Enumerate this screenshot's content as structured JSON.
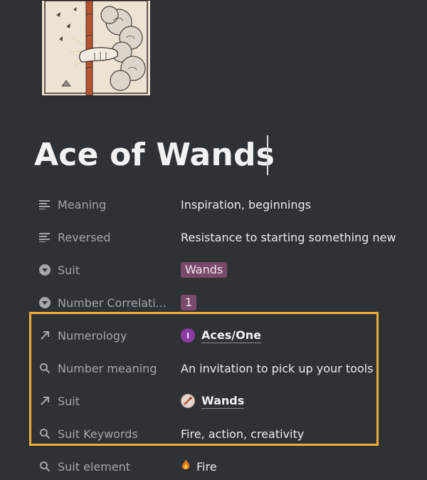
{
  "page": {
    "title": "Ace of Wands"
  },
  "properties": [
    {
      "label": "Meaning",
      "icon": "text-lines-icon",
      "type": "text",
      "value": "Inspiration, beginnings"
    },
    {
      "label": "Reversed",
      "icon": "text-lines-icon",
      "type": "text",
      "value": "Resistance to starting something new"
    },
    {
      "label": "Suit",
      "icon": "select-chevron-icon",
      "type": "select",
      "value": "Wands"
    },
    {
      "label": "Number Correlati...",
      "icon": "select-chevron-icon",
      "type": "select",
      "value": "1"
    },
    {
      "label": "Numerology",
      "icon": "relation-arrow-icon",
      "type": "relation",
      "value": "Aces/One",
      "badge": "I"
    },
    {
      "label": "Number meaning",
      "icon": "magnifier-icon",
      "type": "rollup",
      "value": "An invitation to pick up your tools"
    },
    {
      "label": "Suit",
      "icon": "relation-arrow-icon",
      "type": "relation",
      "value": "Wands"
    },
    {
      "label": "Suit Keywords",
      "icon": "magnifier-icon",
      "type": "rollup",
      "value": "Fire, action, creativity"
    },
    {
      "label": "Suit element",
      "icon": "magnifier-icon",
      "type": "rollup",
      "value": "Fire"
    }
  ],
  "colors": {
    "background": "#2f3235",
    "tag_background": "#7a4a6c",
    "highlight_border": "#f5ac3a",
    "numerology_badge": "#8a3ca4"
  }
}
